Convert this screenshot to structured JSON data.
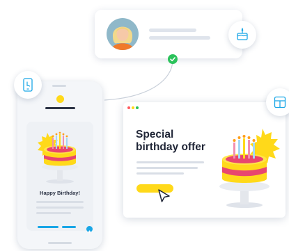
{
  "browser": {
    "offer_title_line1": "Special",
    "offer_title_line2": "birthday offer"
  },
  "phone": {
    "card_text": "Happy Birthday!"
  },
  "icons": {
    "profile_card": "birthday-cake-icon",
    "phone_bubble": "mobile-touch-icon",
    "browser_bubble": "layout-icon"
  },
  "colors": {
    "accent_yellow": "#ffd91a",
    "status_green": "#2bc25b",
    "accent_blue": "#19a6e6",
    "cake_pink": "#e8466f",
    "browser_dots": [
      "#ff5a5f",
      "#ffd91a",
      "#2bc25b"
    ]
  }
}
